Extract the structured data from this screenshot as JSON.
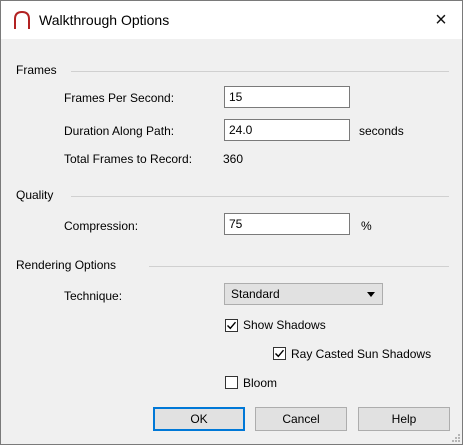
{
  "window": {
    "title": "Walkthrough Options",
    "close_glyph": "×"
  },
  "frames": {
    "group_label": "Frames",
    "fps_label": "Frames Per Second:",
    "fps_value": "15",
    "duration_label": "Duration Along Path:",
    "duration_value": "24.0",
    "duration_unit": "seconds",
    "total_label": "Total Frames to Record:",
    "total_value": "360"
  },
  "quality": {
    "group_label": "Quality",
    "compression_label": "Compression:",
    "compression_value": "75",
    "compression_unit": "%"
  },
  "rendering": {
    "group_label": "Rendering Options",
    "technique_label": "Technique:",
    "technique_value": "Standard",
    "show_shadows_label": "Show Shadows",
    "show_shadows_checked": true,
    "ray_casted_label": "Ray Casted Sun Shadows",
    "ray_casted_checked": true,
    "bloom_label": "Bloom",
    "bloom_checked": false
  },
  "buttons": {
    "ok": "OK",
    "cancel": "Cancel",
    "help": "Help"
  },
  "colors": {
    "accent": "#0078d7",
    "icon_red": "#b22222"
  }
}
